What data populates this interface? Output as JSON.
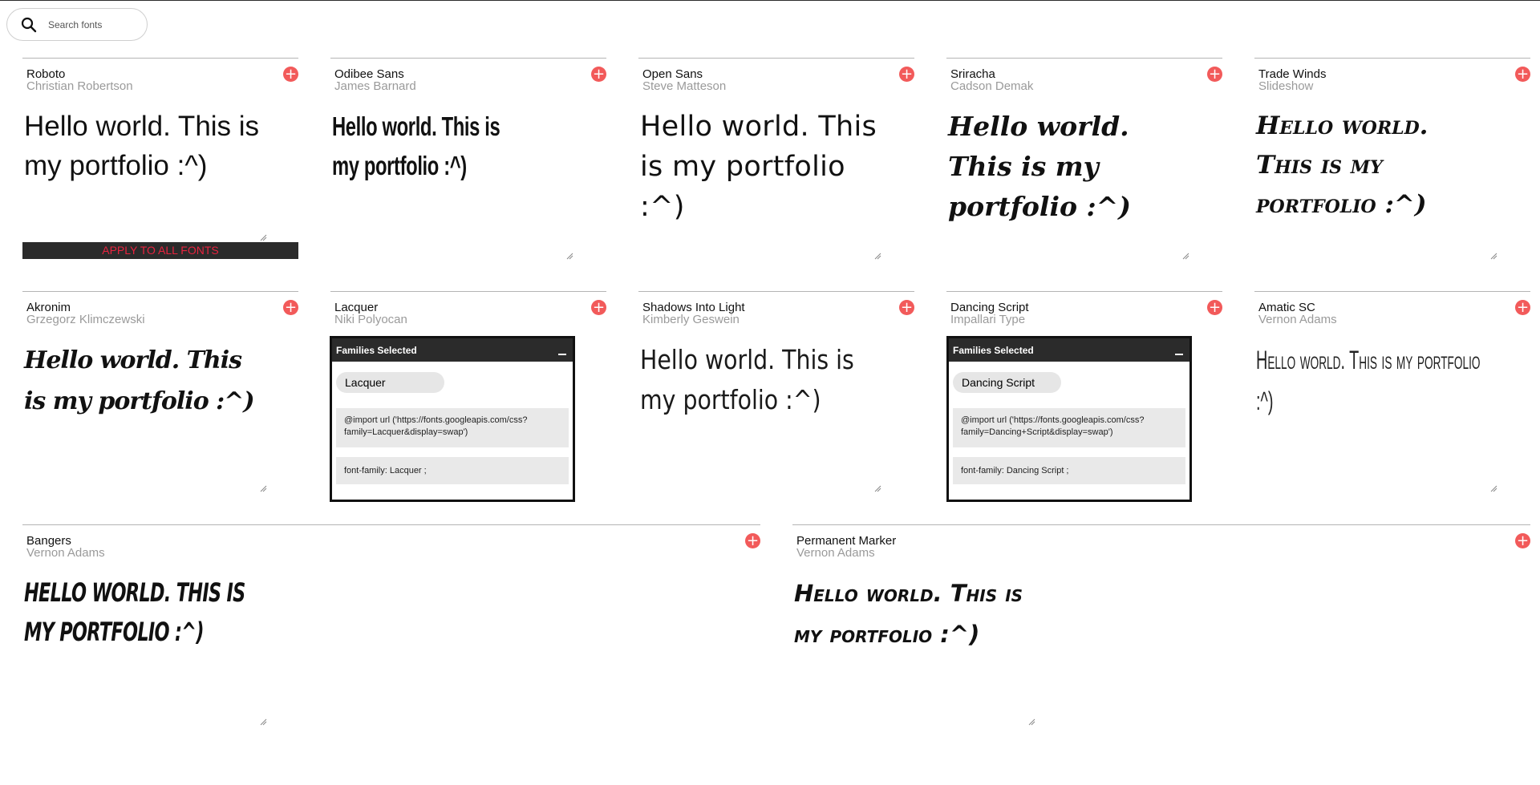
{
  "search": {
    "placeholder": "Search fonts",
    "icon": "search-icon"
  },
  "sample_text": "Hello world. This is my portfolio :^)",
  "apply_label": "APPLY TO ALL FONTS",
  "colors": {
    "accent": "#f25a5a",
    "apply_text": "#e8233f",
    "dark": "#2b2b2b"
  },
  "cards": [
    {
      "name": "Roboto",
      "designer": "Christian Robertson"
    },
    {
      "name": "Odibee Sans",
      "designer": "James Barnard"
    },
    {
      "name": "Open Sans",
      "designer": "Steve Matteson"
    },
    {
      "name": "Sriracha",
      "designer": "Cadson Demak"
    },
    {
      "name": "Trade Winds",
      "designer": "Slideshow"
    },
    {
      "name": "Akronim",
      "designer": "Grzegorz Klimczewski"
    },
    {
      "name": "Lacquer",
      "designer": "Niki Polyocan"
    },
    {
      "name": "Shadows Into Light",
      "designer": "Kimberly Geswein"
    },
    {
      "name": "Dancing Script",
      "designer": "Impallari Type"
    },
    {
      "name": "Amatic SC",
      "designer": "Vernon Adams"
    },
    {
      "name": "Bangers",
      "designer": "Vernon Adams"
    },
    {
      "name": "Permanent Marker",
      "designer": "Vernon Adams"
    }
  ],
  "panels": [
    {
      "title": "Families Selected",
      "chip": "Lacquer",
      "import": "@import url ('https://fonts.googleapis.com/css?family=Lacquer&display=swap')",
      "family": "font-family: Lacquer ;"
    },
    {
      "title": "Families Selected",
      "chip": "Dancing Script",
      "import": "@import url ('https://fonts.googleapis.com/css?family=Dancing+Script&display=swap')",
      "family": "font-family: Dancing Script ;"
    }
  ]
}
